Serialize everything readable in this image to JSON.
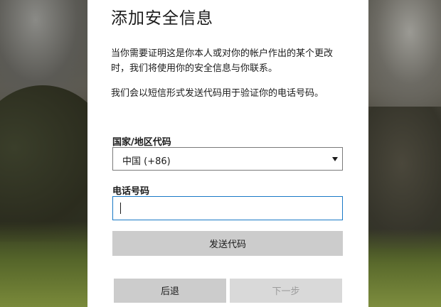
{
  "dialog": {
    "title": "添加安全信息",
    "description_1": "当你需要证明这是你本人或对你的帐户作出的某个更改时，我们将使用你的安全信息与你联系。",
    "description_2": "我们会以短信形式发送代码用于验证你的电话号码。"
  },
  "form": {
    "country_label": "国家/地区代码",
    "country_value": "中国 (+86)",
    "phone_label": "电话号码",
    "phone_value": ""
  },
  "buttons": {
    "send_code": "发送代码",
    "back": "后退",
    "next": "下一步"
  },
  "colors": {
    "focus_border": "#1979c6",
    "button_bg": "#cccccc",
    "disabled_text": "#9c9c9c"
  }
}
